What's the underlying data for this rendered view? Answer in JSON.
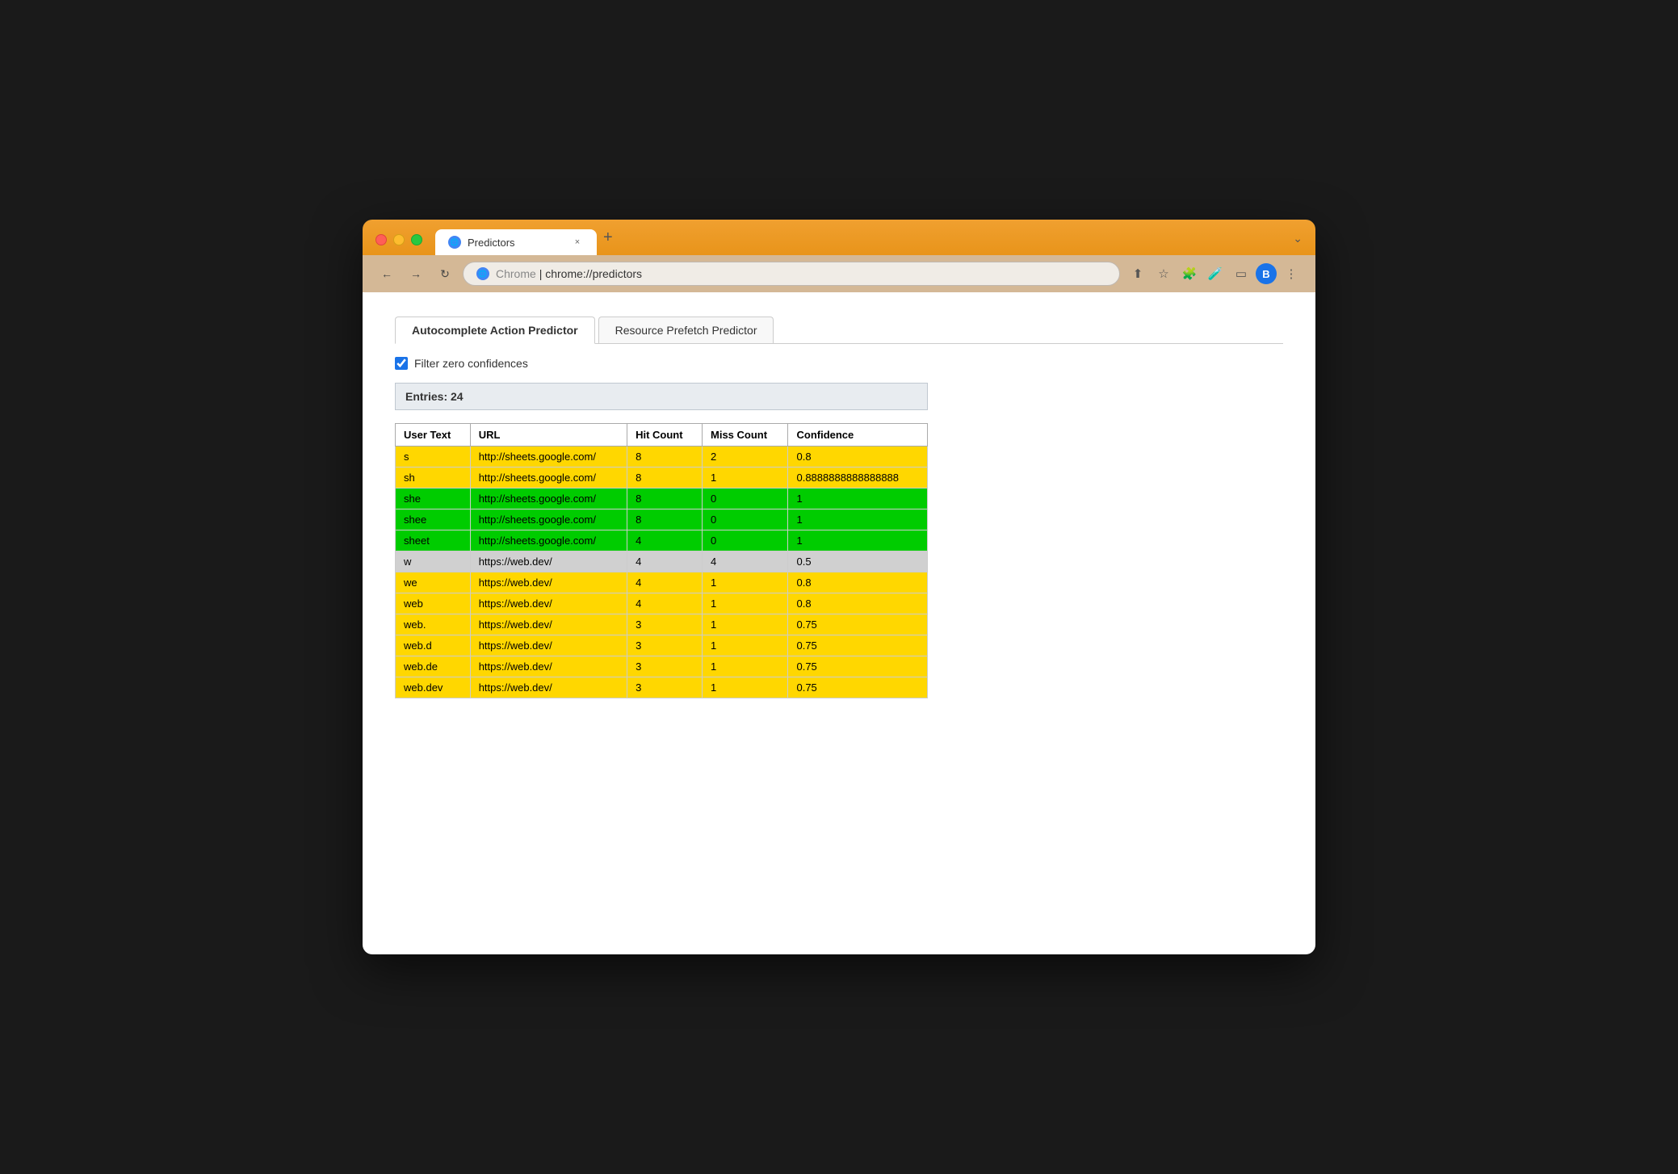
{
  "browser": {
    "tab_title": "Predictors",
    "tab_close": "×",
    "tab_new": "+",
    "tab_chevron": "⌄",
    "address_label": "Chrome",
    "address_separator": "|",
    "address_url": "chrome://predictors",
    "nav_back": "←",
    "nav_forward": "→",
    "nav_refresh": "↻",
    "profile_initial": "B"
  },
  "page": {
    "tabs": [
      {
        "label": "Autocomplete Action Predictor",
        "active": true
      },
      {
        "label": "Resource Prefetch Predictor",
        "active": false
      }
    ],
    "filter_label": "Filter zero confidences",
    "filter_checked": true,
    "entries_label": "Entries: 24"
  },
  "table": {
    "headers": [
      "User Text",
      "URL",
      "Hit Count",
      "Miss Count",
      "Confidence"
    ],
    "rows": [
      {
        "user_text": "s",
        "url": "http://sheets.google.com/",
        "hit_count": "8",
        "miss_count": "2",
        "confidence": "0.8",
        "color": "yellow"
      },
      {
        "user_text": "sh",
        "url": "http://sheets.google.com/",
        "hit_count": "8",
        "miss_count": "1",
        "confidence": "0.8888888888888888",
        "color": "yellow"
      },
      {
        "user_text": "she",
        "url": "http://sheets.google.com/",
        "hit_count": "8",
        "miss_count": "0",
        "confidence": "1",
        "color": "green"
      },
      {
        "user_text": "shee",
        "url": "http://sheets.google.com/",
        "hit_count": "8",
        "miss_count": "0",
        "confidence": "1",
        "color": "green"
      },
      {
        "user_text": "sheet",
        "url": "http://sheets.google.com/",
        "hit_count": "4",
        "miss_count": "0",
        "confidence": "1",
        "color": "green"
      },
      {
        "user_text": "w",
        "url": "https://web.dev/",
        "hit_count": "4",
        "miss_count": "4",
        "confidence": "0.5",
        "color": "gray"
      },
      {
        "user_text": "we",
        "url": "https://web.dev/",
        "hit_count": "4",
        "miss_count": "1",
        "confidence": "0.8",
        "color": "yellow"
      },
      {
        "user_text": "web",
        "url": "https://web.dev/",
        "hit_count": "4",
        "miss_count": "1",
        "confidence": "0.8",
        "color": "yellow"
      },
      {
        "user_text": "web.",
        "url": "https://web.dev/",
        "hit_count": "3",
        "miss_count": "1",
        "confidence": "0.75",
        "color": "yellow"
      },
      {
        "user_text": "web.d",
        "url": "https://web.dev/",
        "hit_count": "3",
        "miss_count": "1",
        "confidence": "0.75",
        "color": "yellow"
      },
      {
        "user_text": "web.de",
        "url": "https://web.dev/",
        "hit_count": "3",
        "miss_count": "1",
        "confidence": "0.75",
        "color": "yellow"
      },
      {
        "user_text": "web.dev",
        "url": "https://web.dev/",
        "hit_count": "3",
        "miss_count": "1",
        "confidence": "0.75",
        "color": "yellow"
      }
    ]
  }
}
